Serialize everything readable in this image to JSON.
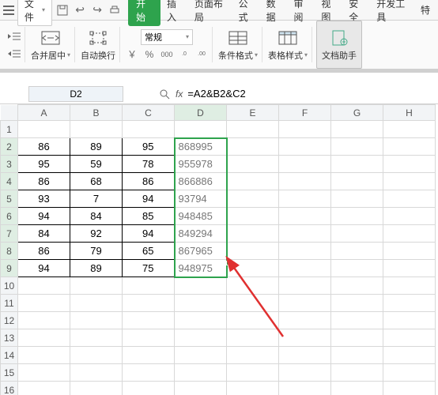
{
  "menubar": {
    "file": "文件",
    "tabs": [
      "开始",
      "插入",
      "页面布局",
      "公式",
      "数据",
      "审阅",
      "视图",
      "安全",
      "开发工具",
      "特"
    ]
  },
  "ribbon": {
    "merge": "合并居中",
    "wrap": "自动换行",
    "format_sel": "常规",
    "cond_fmt": "条件格式",
    "table_style": "表格样式",
    "doc_helper": "文档助手",
    "currency": "￥",
    "percent": "%",
    "thousands": "000",
    "dec_inc": ".0→.00",
    "dec_dec": ".00→.0"
  },
  "formula": {
    "namebox": "D2",
    "fx": "fx",
    "value": "=A2&B2&C2"
  },
  "columns": [
    "A",
    "B",
    "C",
    "D",
    "E",
    "F",
    "G",
    "H"
  ],
  "rows": [
    {
      "r": 1
    },
    {
      "r": 2,
      "a": "86",
      "b": "89",
      "c": "95",
      "d": "868995"
    },
    {
      "r": 3,
      "a": "95",
      "b": "59",
      "c": "78",
      "d": "955978"
    },
    {
      "r": 4,
      "a": "86",
      "b": "68",
      "c": "86",
      "d": "866886"
    },
    {
      "r": 5,
      "a": "93",
      "b": "7",
      "c": "94",
      "d": "93794"
    },
    {
      "r": 6,
      "a": "94",
      "b": "84",
      "c": "85",
      "d": "948485"
    },
    {
      "r": 7,
      "a": "84",
      "b": "92",
      "c": "94",
      "d": "849294"
    },
    {
      "r": 8,
      "a": "86",
      "b": "79",
      "c": "65",
      "d": "867965"
    },
    {
      "r": 9,
      "a": "94",
      "b": "89",
      "c": "75",
      "d": "948975"
    },
    {
      "r": 10
    },
    {
      "r": 11
    },
    {
      "r": 12
    },
    {
      "r": 13
    },
    {
      "r": 14
    },
    {
      "r": 15
    },
    {
      "r": 16
    }
  ]
}
